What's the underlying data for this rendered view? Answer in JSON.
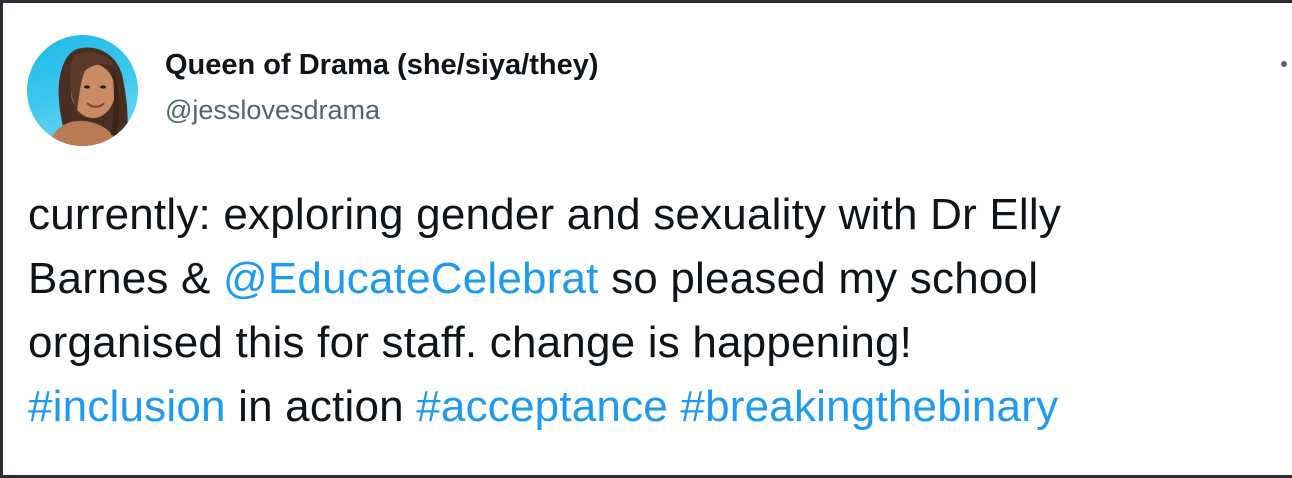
{
  "tweet": {
    "author": {
      "display_name": "Queen of Drama (she/siya/they)",
      "handle": "@jesslovesdrama",
      "avatar_icon": "profile-photo"
    },
    "more_icon": "more-options-icon",
    "text_lines": [
      [
        {
          "text": "currently: exploring gender and sexuality with Dr Elly",
          "link": false
        }
      ],
      [
        {
          "text": "Barnes & ",
          "link": false
        },
        {
          "text": "@EducateCelebrat",
          "link": true
        },
        {
          "text": " so pleased my school",
          "link": false
        }
      ],
      [
        {
          "text": "organised this for staff. change is happening!",
          "link": false
        }
      ],
      [
        {
          "text": "#inclusion",
          "link": true
        },
        {
          "text": " in action ",
          "link": false
        },
        {
          "text": "#acceptance",
          "link": true
        },
        {
          "text": " ",
          "link": false
        },
        {
          "text": "#breakingthebinary",
          "link": true
        }
      ]
    ]
  },
  "colors": {
    "text": "#0f1419",
    "secondary": "#536471",
    "link": "#1d9bf0"
  }
}
